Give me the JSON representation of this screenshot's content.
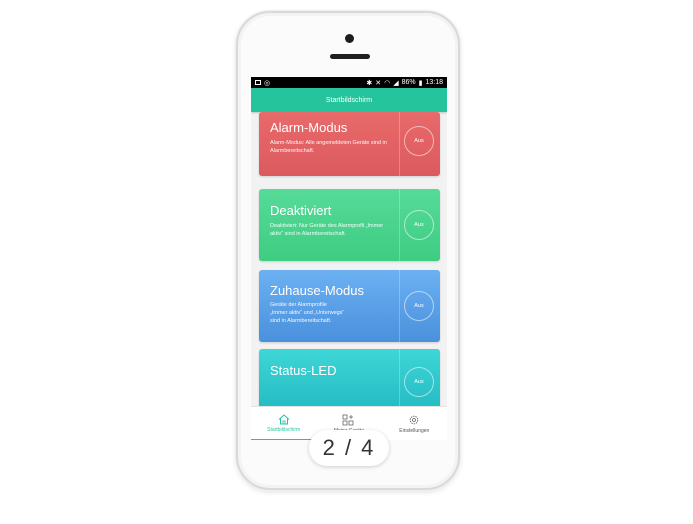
{
  "statusbar": {
    "icons_left": [
      "image-icon",
      "whatsapp-icon"
    ],
    "icons_right": [
      "bluetooth-icon",
      "mute-icon",
      "wifi-icon",
      "signal-icon",
      "battery-icon"
    ],
    "battery": "86%",
    "time": "13:18"
  },
  "appbar": {
    "title": "Startbildschirm"
  },
  "cards": [
    {
      "title": "Alarm-Modus",
      "desc": "Alarm-Modus: Alle angemeldeten Geräte sind in Alarmbereitschaft.",
      "button": "Aus",
      "color": "#e0605f"
    },
    {
      "title": "Deaktiviert",
      "desc": "Deaktiviert: Nur Geräte des Alarmprofil „Immer aktiv“ sind in Alarmbereitschaft.",
      "button": "Aus",
      "color": "#45d28b"
    },
    {
      "title": "Zuhause-Modus",
      "desc_lines": [
        "Geräte der Alarmprofile",
        "„Immer aktiv“ und „Unterwegs“",
        "sind in Alarmbereitschaft."
      ],
      "button": "Aus",
      "color": "#5a9fe6"
    },
    {
      "title": "Status-LED",
      "button": "Aus",
      "color": "#2fc8cc"
    }
  ],
  "nav": {
    "items": [
      {
        "label": "Startbildschirm",
        "icon": "home-icon",
        "active": true
      },
      {
        "label": "Meine Geräte",
        "icon": "devices-grid-icon",
        "active": false
      },
      {
        "label": "Einstellungen",
        "icon": "gear-icon",
        "active": false
      }
    ],
    "accent": "#26c49c"
  },
  "pager": {
    "text": "2 / 4"
  }
}
